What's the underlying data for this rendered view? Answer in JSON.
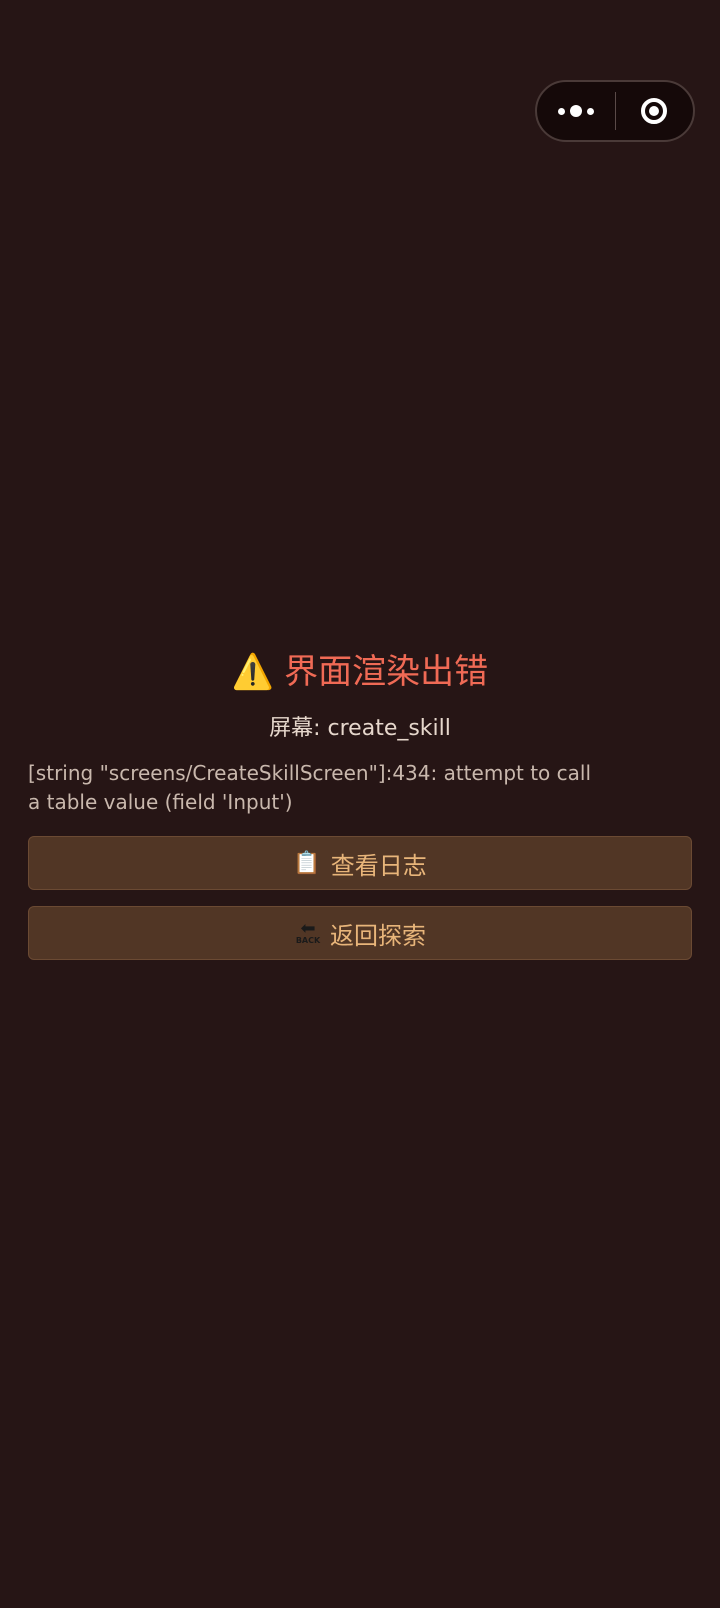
{
  "capsule": {
    "menu_icon": "more-dots-icon",
    "close_icon": "target-circle-icon"
  },
  "error": {
    "icon": "⚠️",
    "title": "界面渲染出错",
    "screen_label": "屏幕: create_skill",
    "message": "[string \"screens/CreateSkillScreen\"]:434: attempt to call a table value (field 'Input')"
  },
  "buttons": {
    "logs": {
      "icon": "📋",
      "label": "查看日志"
    },
    "back": {
      "icon_text": "BACK",
      "label": "返回探索"
    }
  },
  "colors": {
    "background": "#261515",
    "title": "#f06a55",
    "button_bg": "#513625",
    "button_text": "#e8b57a"
  }
}
